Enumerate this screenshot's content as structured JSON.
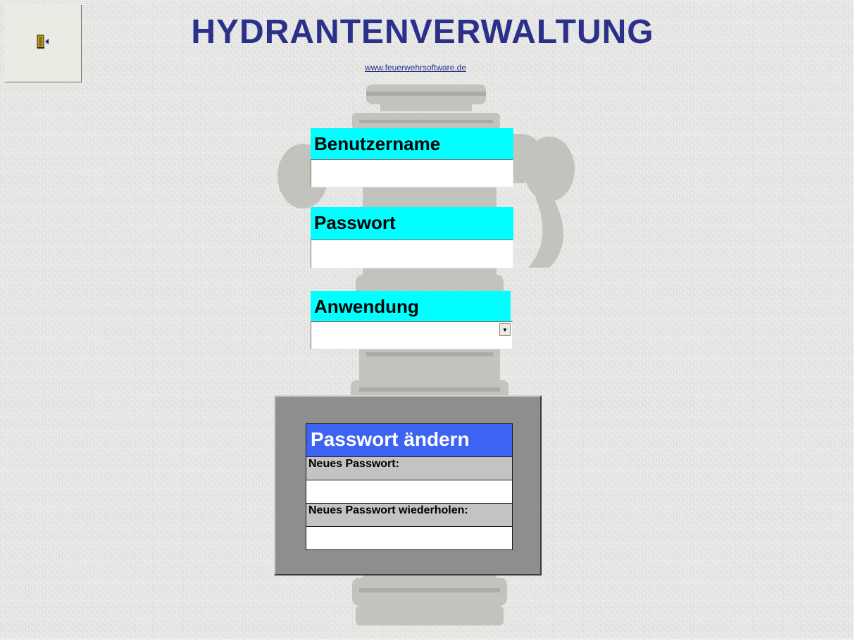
{
  "header": {
    "title": "HYDRANTENVERWALTUNG",
    "website": "www.feuerwehrsoftware.de"
  },
  "toolbar": {
    "exit_icon": "exit-door-icon"
  },
  "login": {
    "username_label": "Benutzername",
    "username_value": "",
    "password_label": "Passwort",
    "password_value": "",
    "application_label": "Anwendung",
    "application_value": ""
  },
  "change_password": {
    "title": "Passwort ändern",
    "new_password_label": "Neues Passwort:",
    "new_password_value": "",
    "repeat_password_label": "Neues Passwort wiederholen:",
    "repeat_password_value": ""
  },
  "colors": {
    "title": "#2b308a",
    "label_bg": "#00ffff",
    "panel_title_bg": "#3d63f2",
    "panel_bg": "#8e8e8e"
  }
}
